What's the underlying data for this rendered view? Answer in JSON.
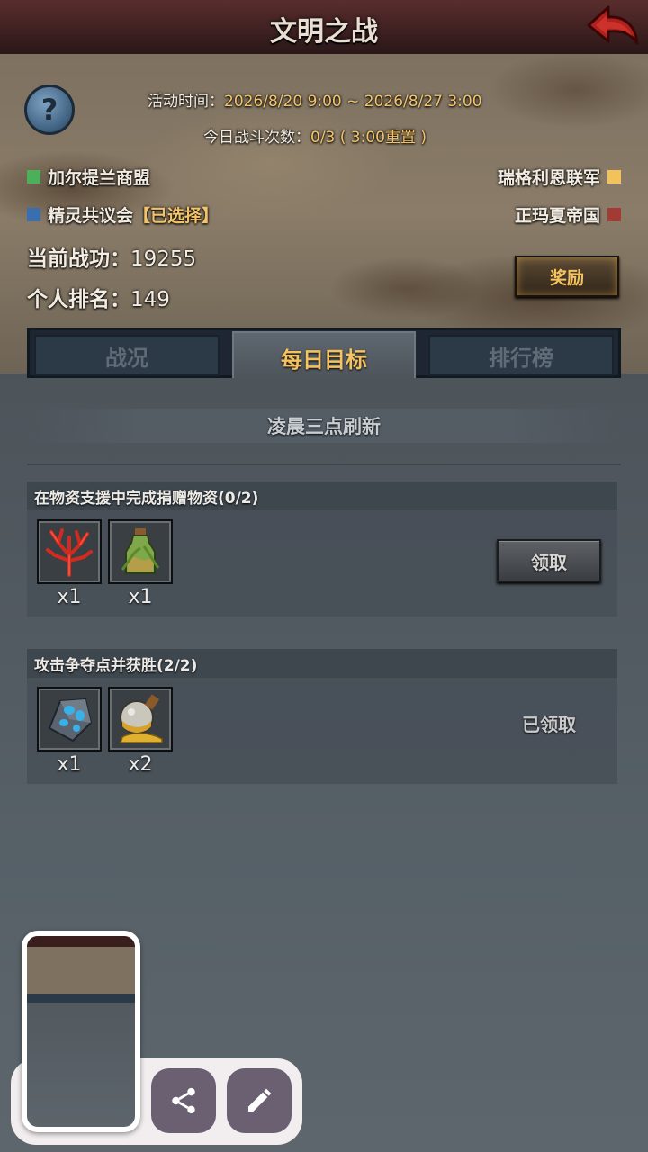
{
  "header": {
    "title": "文明之战"
  },
  "event": {
    "time_label": "活动时间：",
    "time_value": "2026/8/20 9:00 ~ 2026/8/27 3:00",
    "battles_label": "今日战斗次数：",
    "battles_value": "0/3 ( 3:00",
    "battles_reset": "重置 )"
  },
  "factions": [
    {
      "name": "加尔提兰商盟",
      "color": "#4caf59"
    },
    {
      "name": "瑞格利恩联军",
      "color": "#f3c25a"
    },
    {
      "name": "精灵共议会",
      "suffix": "【已选择】",
      "color": "#3a6fae"
    },
    {
      "name": "正玛夏帝国",
      "color": "#a23a35"
    }
  ],
  "stats": {
    "merit_label": "当前战功：",
    "merit_value": "19255",
    "rank_label": "个人排名：",
    "rank_value": "149"
  },
  "reward_button": "奖励",
  "tabs": [
    {
      "label": "战况",
      "active": false
    },
    {
      "label": "每日目标",
      "active": true
    },
    {
      "label": "排行榜",
      "active": false
    }
  ],
  "refresh_note": "凌晨三点刷新",
  "tasks": [
    {
      "title": "在物资支援中完成捐赠物资(0/2)",
      "items": [
        {
          "icon": "red-coral-icon",
          "count": "x1"
        },
        {
          "icon": "herb-bottle-icon",
          "count": "x1"
        }
      ],
      "action": "领取"
    },
    {
      "title": "攻击争夺点并获胜(2/2)",
      "items": [
        {
          "icon": "blue-ore-icon",
          "count": "x1"
        },
        {
          "icon": "gold-potion-icon",
          "count": "x2"
        }
      ],
      "status": "已领取"
    }
  ],
  "overlay": {
    "share_icon": "share-icon",
    "edit_icon": "pencil-icon"
  }
}
